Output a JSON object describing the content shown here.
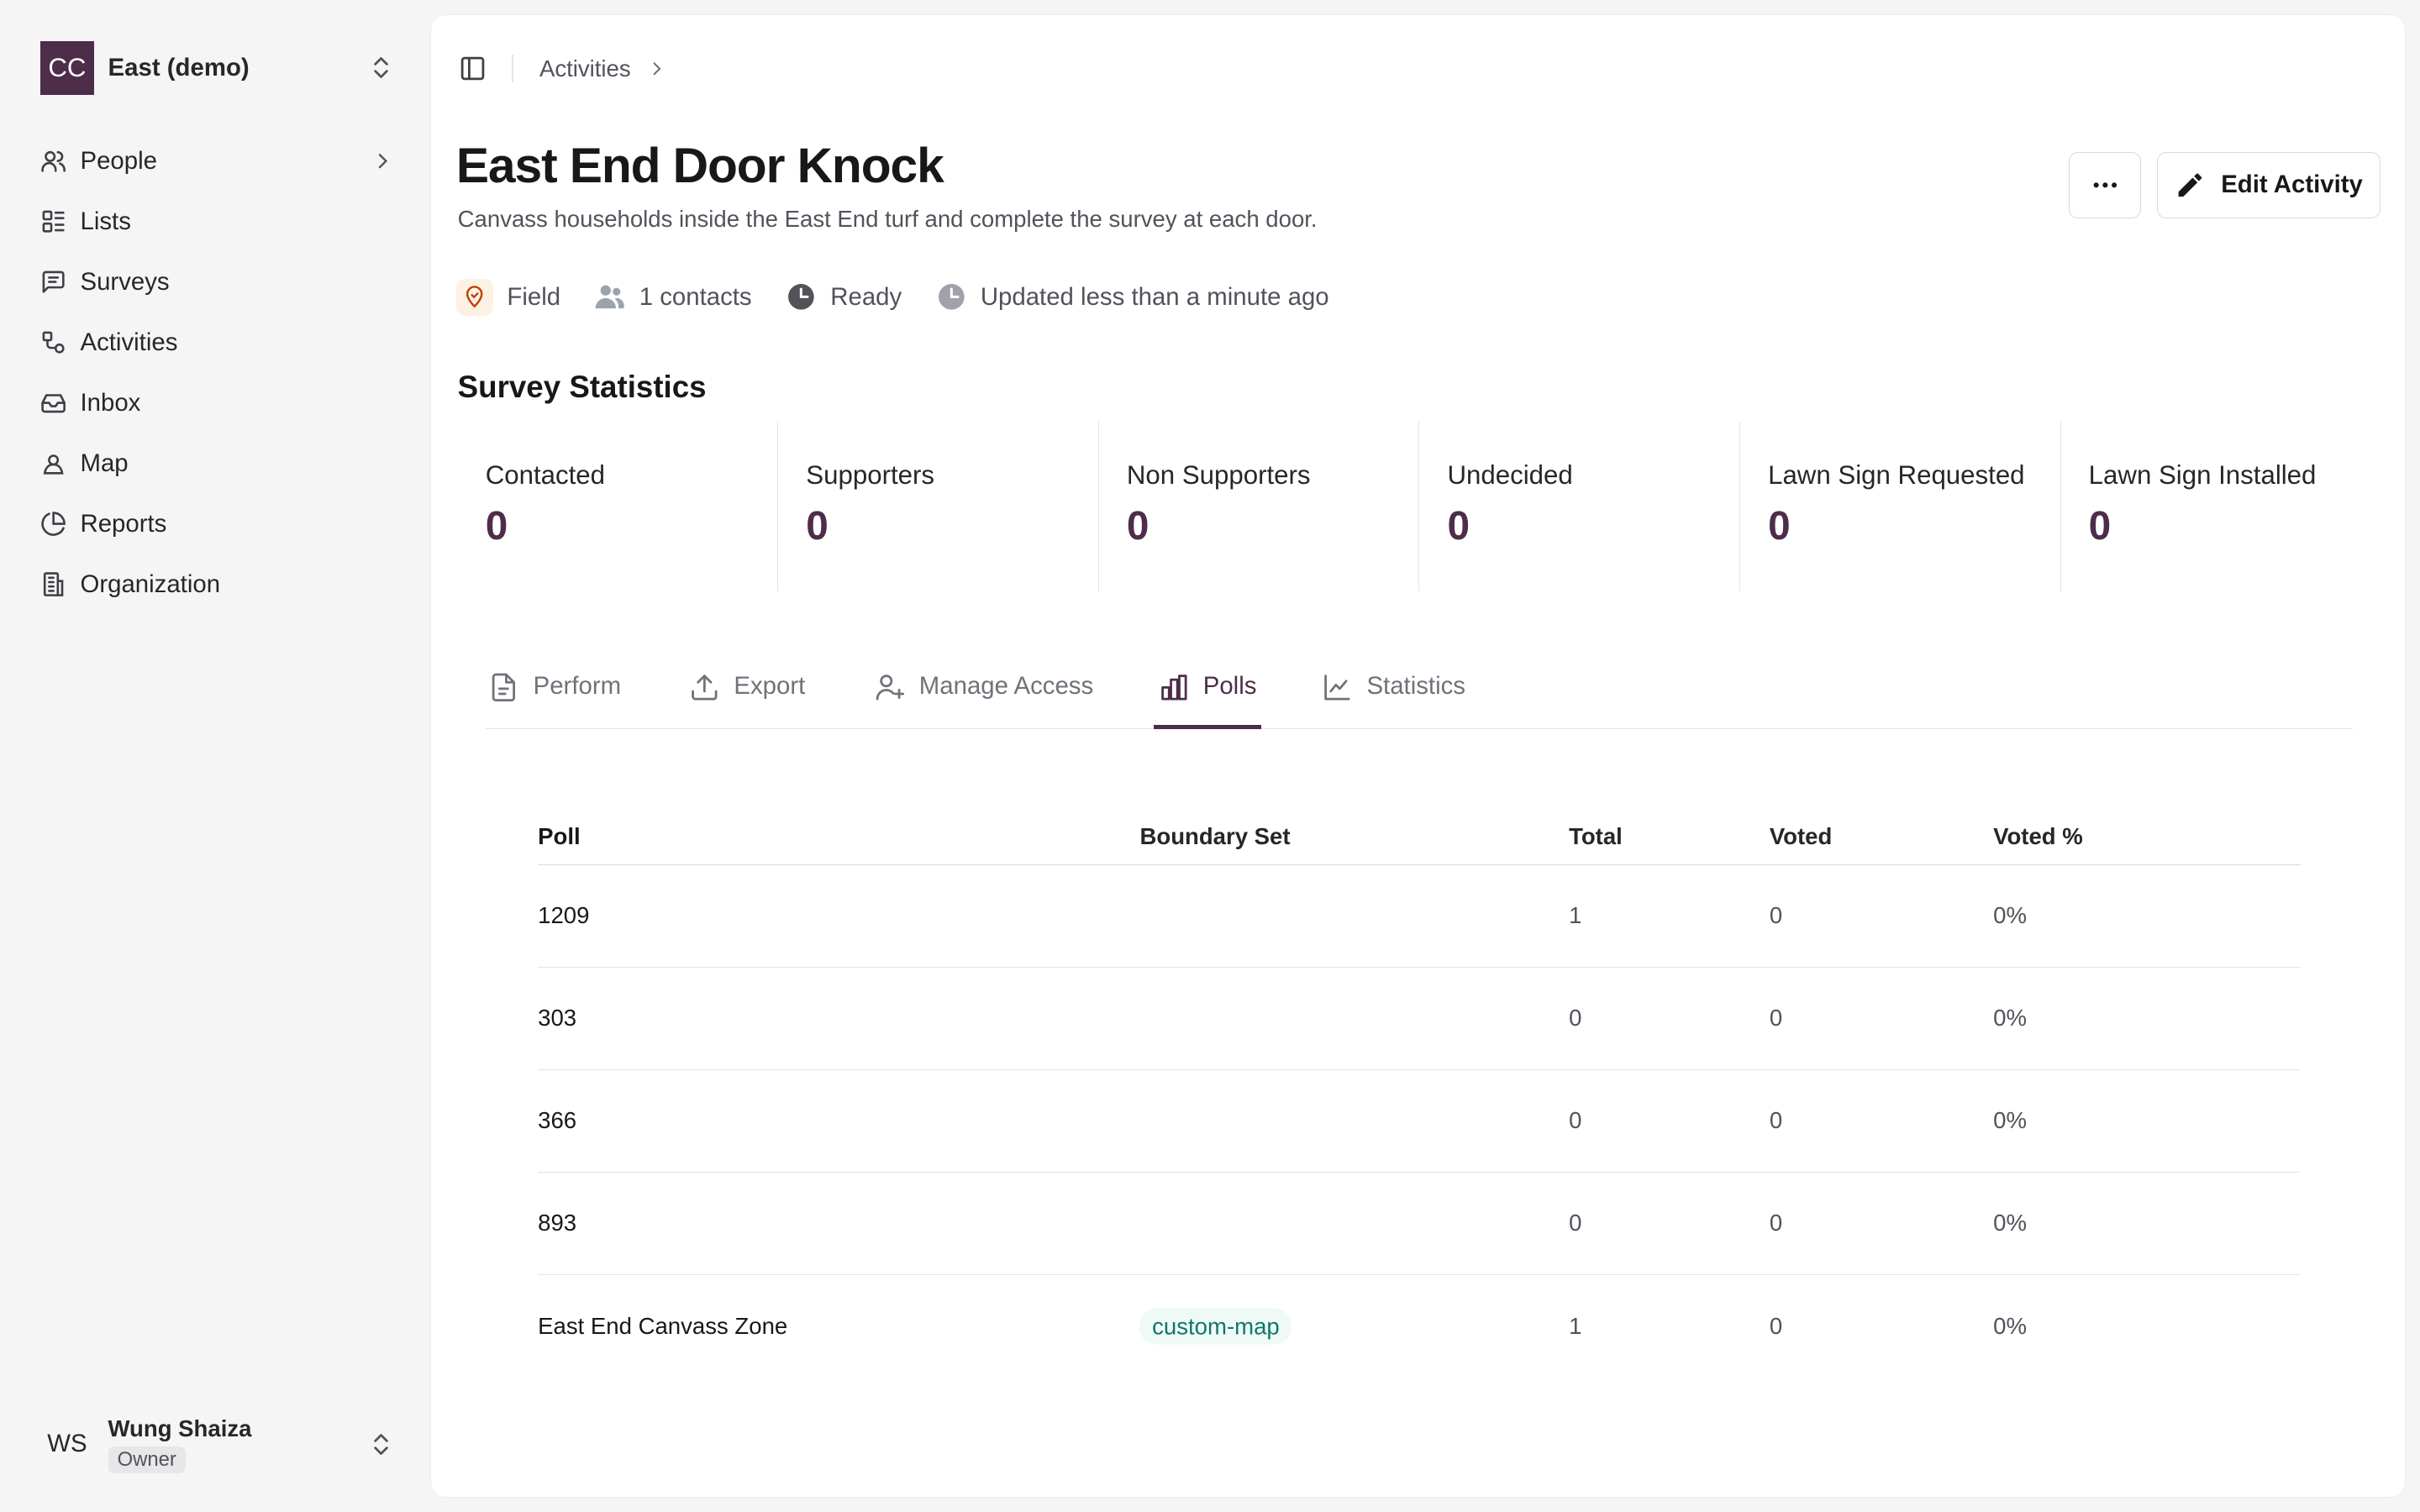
{
  "org": {
    "logo": "CC",
    "name": "East (demo)"
  },
  "nav": [
    {
      "label": "People",
      "icon": "users-icon",
      "has_chevron": true
    },
    {
      "label": "Lists",
      "icon": "list-icon"
    },
    {
      "label": "Surveys",
      "icon": "survey-icon"
    },
    {
      "label": "Activities",
      "icon": "activities-icon"
    },
    {
      "label": "Inbox",
      "icon": "inbox-icon"
    },
    {
      "label": "Map",
      "icon": "map-icon"
    },
    {
      "label": "Reports",
      "icon": "reports-icon"
    },
    {
      "label": "Organization",
      "icon": "building-icon"
    }
  ],
  "user": {
    "initials": "WS",
    "name": "Wung Shaiza",
    "role": "Owner"
  },
  "breadcrumb": {
    "parent": "Activities"
  },
  "activity": {
    "title": "East End Door Knock",
    "description": "Canvass households inside the East End turf and complete the survey at each door.",
    "edit_label": "Edit Activity",
    "meta": {
      "type": "Field",
      "contacts": "1 contacts",
      "status": "Ready",
      "updated": "Updated less than a minute ago"
    }
  },
  "survey": {
    "title": "Survey Statistics",
    "stats": [
      {
        "label": "Contacted",
        "value": "0"
      },
      {
        "label": "Supporters",
        "value": "0"
      },
      {
        "label": "Non Supporters",
        "value": "0"
      },
      {
        "label": "Undecided",
        "value": "0"
      },
      {
        "label": "Lawn Sign Requested",
        "value": "0"
      },
      {
        "label": "Lawn Sign Installed",
        "value": "0"
      }
    ]
  },
  "tabs": [
    {
      "label": "Perform",
      "icon": "document-icon"
    },
    {
      "label": "Export",
      "icon": "upload-icon"
    },
    {
      "label": "Manage Access",
      "icon": "user-plus-icon"
    },
    {
      "label": "Polls",
      "icon": "bar-chart-icon",
      "active": true
    },
    {
      "label": "Statistics",
      "icon": "line-chart-icon"
    }
  ],
  "polls_table": {
    "headers": {
      "poll": "Poll",
      "boundary_set": "Boundary Set",
      "total": "Total",
      "voted": "Voted",
      "voted_pct": "Voted %"
    },
    "rows": [
      {
        "poll": "1209",
        "boundary_set": "",
        "total": "1",
        "voted": "0",
        "voted_pct": "0%"
      },
      {
        "poll": "303",
        "boundary_set": "",
        "total": "0",
        "voted": "0",
        "voted_pct": "0%"
      },
      {
        "poll": "366",
        "boundary_set": "",
        "total": "0",
        "voted": "0",
        "voted_pct": "0%"
      },
      {
        "poll": "893",
        "boundary_set": "",
        "total": "0",
        "voted": "0",
        "voted_pct": "0%"
      },
      {
        "poll": "East End Canvass Zone",
        "boundary_set": "custom-map",
        "total": "1",
        "voted": "0",
        "voted_pct": "0%"
      }
    ]
  },
  "colors": {
    "brand": "#4d2d4a",
    "field_badge_bg": "#fdf1e4",
    "field_icon": "#c2410c",
    "badge_text": "#0f766e"
  }
}
